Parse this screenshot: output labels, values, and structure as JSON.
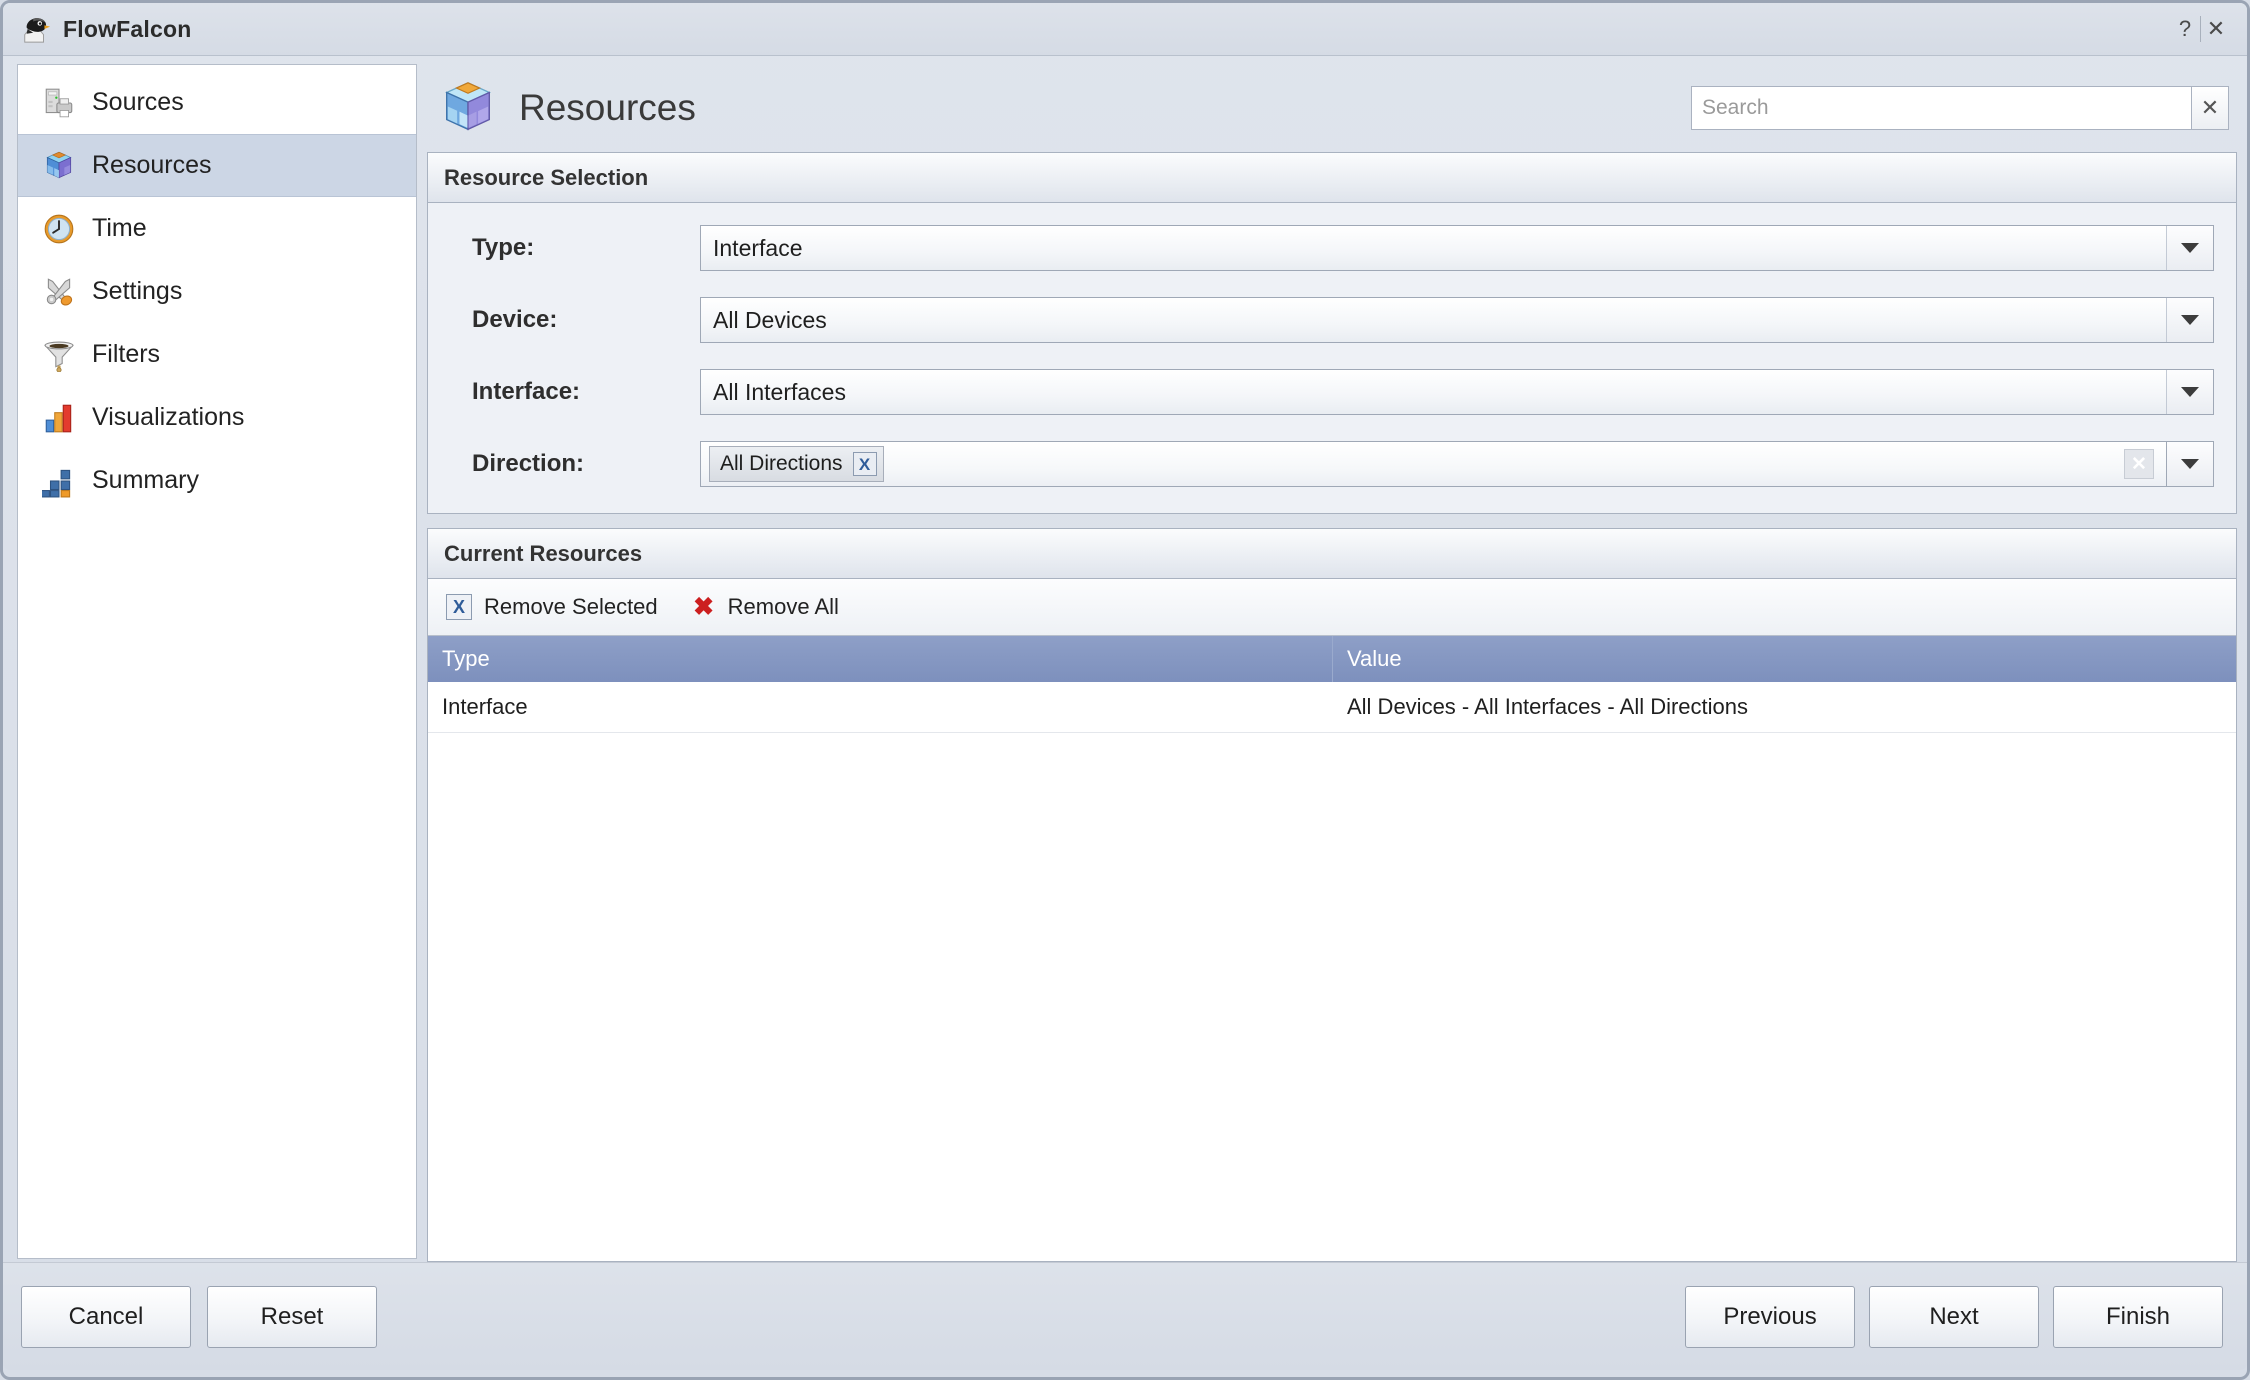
{
  "window": {
    "app_title": "FlowFalcon",
    "app_icon": "falcon-icon",
    "help_label": "?",
    "close_label": "✕"
  },
  "sidebar": {
    "items": [
      {
        "label": "Sources",
        "icon": "server-printer-icon",
        "selected": false
      },
      {
        "label": "Resources",
        "icon": "cube-blocks-icon",
        "selected": true
      },
      {
        "label": "Time",
        "icon": "clock-icon",
        "selected": false
      },
      {
        "label": "Settings",
        "icon": "tools-icon",
        "selected": false
      },
      {
        "label": "Filters",
        "icon": "funnel-icon",
        "selected": false
      },
      {
        "label": "Visualizations",
        "icon": "bar-chart-icon",
        "selected": false
      },
      {
        "label": "Summary",
        "icon": "summary-blocks-icon",
        "selected": false
      }
    ]
  },
  "header": {
    "title": "Resources",
    "icon": "cube-blocks-icon"
  },
  "search": {
    "value": "",
    "placeholder": "Search",
    "clear_label": "✕"
  },
  "resource_selection": {
    "title": "Resource Selection",
    "fields": [
      {
        "label": "Type:",
        "value": "Interface"
      },
      {
        "label": "Device:",
        "value": "All Devices"
      },
      {
        "label": "Interface:",
        "value": "All Interfaces"
      }
    ],
    "direction": {
      "label": "Direction:",
      "token": "All Directions",
      "token_remove_label": "X",
      "clear_label": "✕"
    }
  },
  "current_resources": {
    "title": "Current Resources",
    "toolbar": {
      "remove_selected_label": "Remove Selected",
      "remove_selected_icon": "x-box-blue-icon",
      "remove_all_label": "Remove All",
      "remove_all_icon": "x-red-icon"
    },
    "columns": [
      "Type",
      "Value"
    ],
    "rows": [
      {
        "type": "Interface",
        "value": "All Devices - All Interfaces - All Directions"
      }
    ]
  },
  "footer": {
    "cancel_label": "Cancel",
    "reset_label": "Reset",
    "previous_label": "Previous",
    "next_label": "Next",
    "finish_label": "Finish"
  },
  "colors": {
    "window_chrome": "#d7dde7",
    "selected_nav": "#ccd6e5",
    "table_header": "#7d90bd",
    "accent_blue": "#2f5c99",
    "accent_red": "#cc1f1f",
    "panel_bg": "#eef1f6"
  }
}
